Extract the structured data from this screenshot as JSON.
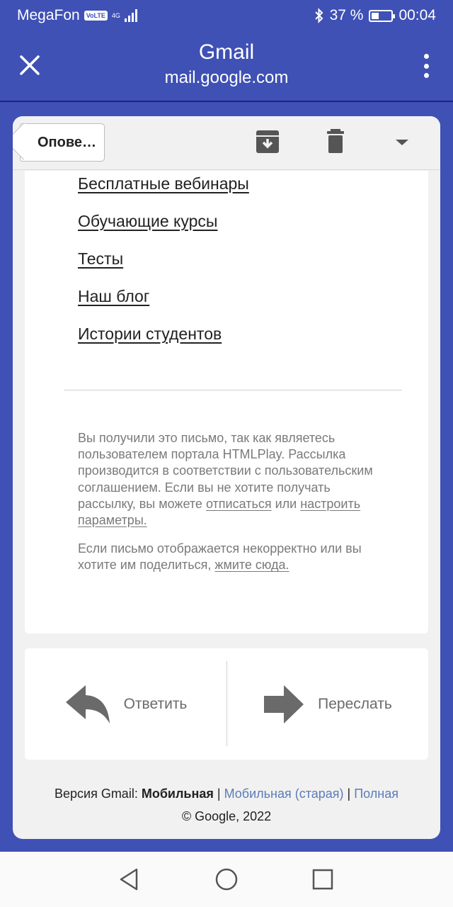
{
  "status_bar": {
    "carrier": "MegaFon",
    "volte": "VoLTE",
    "network": "4G",
    "battery": "37 %",
    "time": "00:04",
    "battery_level": 0.37
  },
  "app_header": {
    "title": "Gmail",
    "subtitle": "mail.google.com",
    "close_icon": "close-icon",
    "menu_icon": "more-vert-icon"
  },
  "toolbar": {
    "back_label": "Опове…",
    "archive_icon": "archive-icon",
    "delete_icon": "trash-icon",
    "more_icon": "dropdown-arrow-icon"
  },
  "email": {
    "links": [
      "Бесплатные вебинары",
      "Обучающие курсы",
      "Тесты",
      "Наш блог",
      "Истории студентов"
    ],
    "notice1": {
      "text": "Вы получили это письмо, так как являетесь пользователем портала HTMLPlay. Рассылка производится в соответствии с пользовательским соглашением. Если вы не хотите получать рассылку, вы можете ",
      "unsubscribe": "отписаться",
      "or": " или ",
      "settings": "настроить параметры."
    },
    "notice2": {
      "text": "Если письмо отображается некорректно или вы хотите им поделиться, ",
      "link": "жмите сюда."
    }
  },
  "actions": {
    "reply": "Ответить",
    "forward": "Переслать"
  },
  "footer": {
    "version_prefix": "Версия Gmail: ",
    "current": "Мобильная",
    "sep": " | ",
    "old_mobile": "Мобильная (старая)",
    "full": "Полная",
    "copyright": "© Google, 2022"
  },
  "colors": {
    "header": "#3f51b5",
    "link_blue": "#5c7cb8",
    "muted_text": "#7a7a7a"
  }
}
